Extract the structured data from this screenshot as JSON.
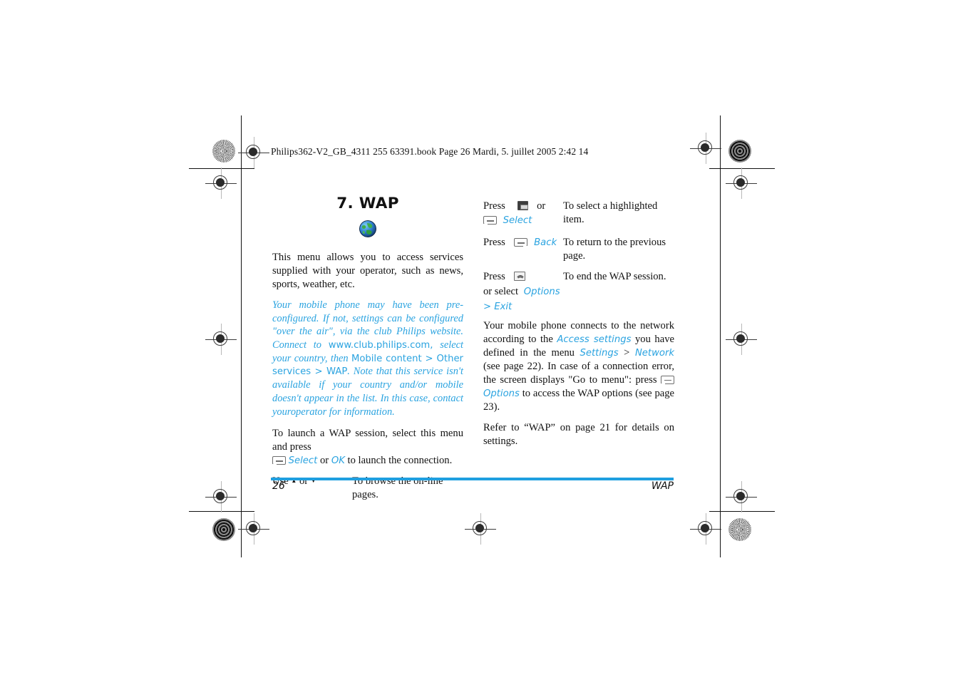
{
  "document": {
    "running_head": "Philips362-V2_GB_4311 255 63391.book  Page 26  Mardi, 5. juillet 2005  2:42 14",
    "accent_color": "#2aa3e0",
    "text_color": "#111111"
  },
  "left_column": {
    "chapter_title": "7. WAP",
    "icon": "globe-icon",
    "intro": "This menu allows you to access services supplied with your operator, such as news, sports, weather, etc.",
    "note": {
      "part1": "Your mobile phone may have been pre-configured. If not, settings can be configured \"over the air\", via the club Philips website. Connect to ",
      "url": "www.club.philips.com,",
      "part2": " select your country, then ",
      "path1": "Mobile content > Other services > WAP",
      "part3": ". Note that this service isn't available if your country and/or mobile doesn't appear in the list. In this case, contact youroperator for information."
    },
    "launch": {
      "text1": "To launch a WAP session, select this menu and press",
      "key": "soft-key-left-icon",
      "label_select": "Select",
      "text_or": "or",
      "label_ok": "OK",
      "text2": "to launch the connection."
    },
    "browse_row": {
      "use": "Use",
      "up_arrow": "▲",
      "or": "or",
      "down_arrow": "▼",
      "action": "To browse the on-line pages."
    }
  },
  "right_column": {
    "rows": [
      {
        "press": "Press",
        "key1": "nav-ok-key-icon",
        "or": "or",
        "key2": "soft-key-left-icon",
        "label": "Select",
        "action": "To select a highlighted item."
      },
      {
        "press": "Press",
        "key1": "soft-key-right-icon",
        "label": "Back",
        "action": "To return to the previous page."
      },
      {
        "press": "Press",
        "key1": "hangup-key-icon",
        "or_select": "or  select",
        "label": "Options",
        "sub": "> ",
        "sub_label": "Exit",
        "action": "To end the WAP session."
      }
    ],
    "paragraph": {
      "p1": "Your mobile phone connects to the network according to the ",
      "link1": "Access settings",
      "p2": " you have defined in the menu ",
      "link2": "Settings",
      "p3": " > ",
      "link3": "Network",
      "p4": " (see page 22). In case of a connection error, the screen displays \"Go to menu\": press ",
      "key": "soft-key-left-icon",
      "link4": "Options",
      "p5": " to access the WAP options (see page 23)."
    },
    "refer": "Refer to “WAP” on page 21 for details on settings."
  },
  "footer": {
    "page_number": "26",
    "section": "WAP"
  }
}
